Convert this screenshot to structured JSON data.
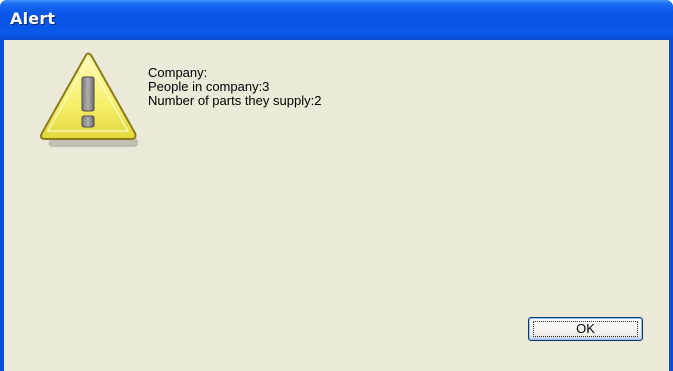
{
  "window": {
    "title": "Alert"
  },
  "alert": {
    "icon": "warning-icon",
    "lines": [
      "Company:",
      "People in company:3",
      "Number of parts they supply:2"
    ]
  },
  "buttons": {
    "ok_label": "OK"
  },
  "colors": {
    "titlebar": "#0a58e8",
    "client_bg": "#ece9d8",
    "warning_fill": "#f7f27a"
  }
}
